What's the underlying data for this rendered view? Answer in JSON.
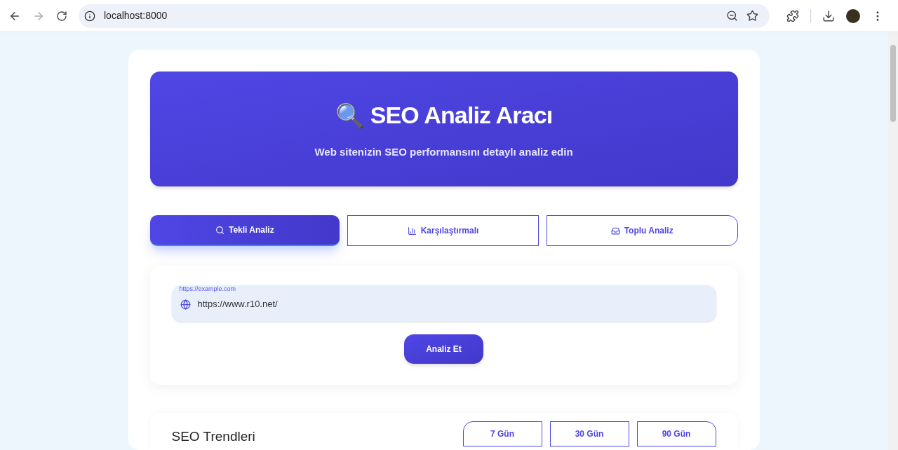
{
  "browser": {
    "url": "localhost:8000"
  },
  "header": {
    "emoji": "🔍",
    "title": "SEO Analiz Aracı",
    "subtitle": "Web sitenizin SEO performansını detaylı analiz edin"
  },
  "tabs": [
    {
      "kind": "search",
      "label": "Tekli Analiz",
      "selected": true
    },
    {
      "kind": "chart",
      "label": "Karşılaştırmalı",
      "selected": false
    },
    {
      "kind": "tray",
      "label": "Toplu Analiz",
      "selected": false
    }
  ],
  "url_input": {
    "placeholder": "https://example.com",
    "value": "https://www.r10.net/"
  },
  "analyze_button": "Analiz Et",
  "trends": {
    "title": "SEO Trendleri",
    "ranges": [
      {
        "label": "7 Gün",
        "selected": false
      },
      {
        "label": "30 Gün",
        "selected": false
      },
      {
        "label": "90 Gün",
        "selected": false
      }
    ]
  }
}
